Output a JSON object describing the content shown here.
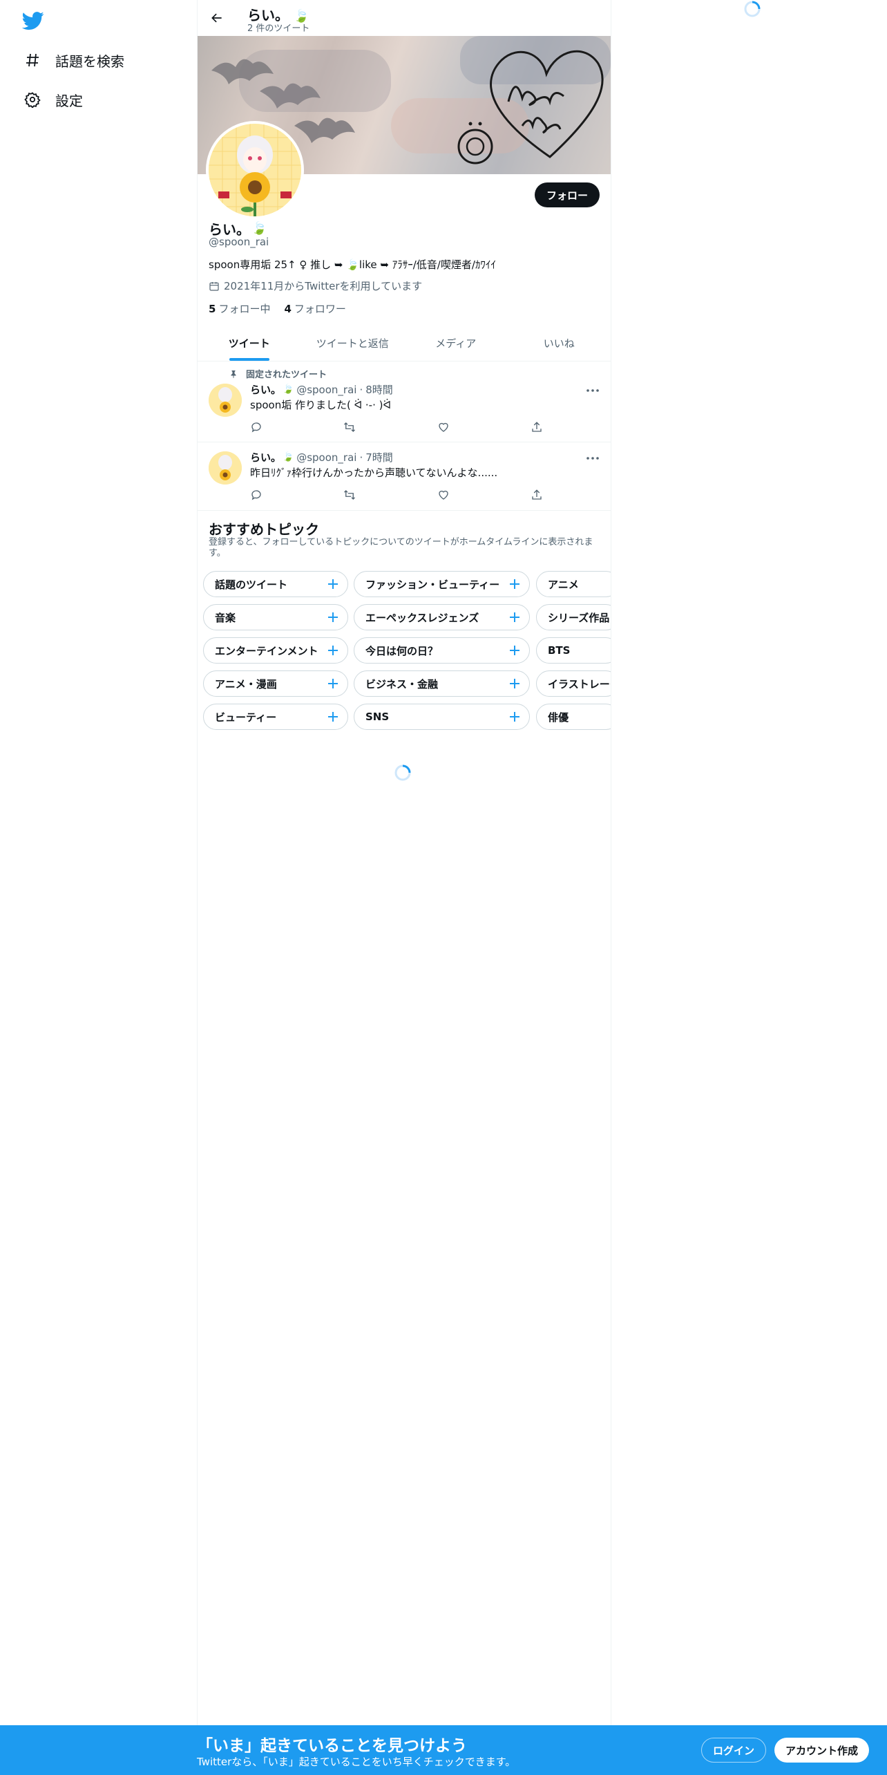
{
  "colors": {
    "brand": "#1d9bf0",
    "text": "#0f1419",
    "secondary": "#536471",
    "border": "#cfd9de"
  },
  "nav": {
    "logo_icon": "twitter-bird-icon",
    "items": [
      {
        "label": "話題を検索",
        "icon": "hashtag-icon"
      },
      {
        "label": "設定",
        "icon": "gear-icon"
      }
    ]
  },
  "header": {
    "name": "らい。",
    "tweet_count": "2 件のツイート"
  },
  "profile": {
    "name": "らい。",
    "handle": "@spoon_rai",
    "bio": "spoon専用垢 25↑ ♀ 推し ➥ 🍃like ➥ ｱﾗｻｰ/低音/喫煙者/ｶﾜｲｲ",
    "joined": "2021年11月からTwitterを利用しています",
    "following_count": "5",
    "following_label": "フォロー中",
    "followers_count": "4",
    "followers_label": "フォロワー",
    "follow_button": "フォロー"
  },
  "tabs": [
    "ツイート",
    "ツイートと返信",
    "メディア",
    "いいね"
  ],
  "tweets": [
    {
      "pinned_label": "固定されたツイート",
      "name": "らい。",
      "handle": "@spoon_rai",
      "time": "8時間",
      "text": "spoon垢 作りました( ᐛ ·-· )ᐛ"
    },
    {
      "name": "らい。",
      "handle": "@spoon_rai",
      "time": "7時間",
      "text": "昨日ﾘｸﾞｧ枠行けんかったから声聴いてないんよな......"
    }
  ],
  "topics": {
    "title": "おすすめトピック",
    "subtitle": "登録すると、フォローしているトピックについてのツイートがホームタイムラインに表示されます。",
    "rows": [
      [
        "話題のツイート",
        "ファッション・ビューティー",
        "アニメ"
      ],
      [
        "音楽",
        "エーペックスレジェンズ",
        "シリーズ作品"
      ],
      [
        "エンターテインメント",
        "今日は何の日？",
        "BTS"
      ],
      [
        "アニメ・漫画",
        "ビジネス・金融",
        "イラストレーター"
      ],
      [
        "ビューティー",
        "SNS",
        "俳優"
      ]
    ]
  },
  "bottom_bar": {
    "title": "「いま」起きていることを見つけよう",
    "subtitle": "Twitterなら、「いま」起きていることをいち早くチェックできます。",
    "login": "ログイン",
    "signup": "アカウント作成"
  }
}
